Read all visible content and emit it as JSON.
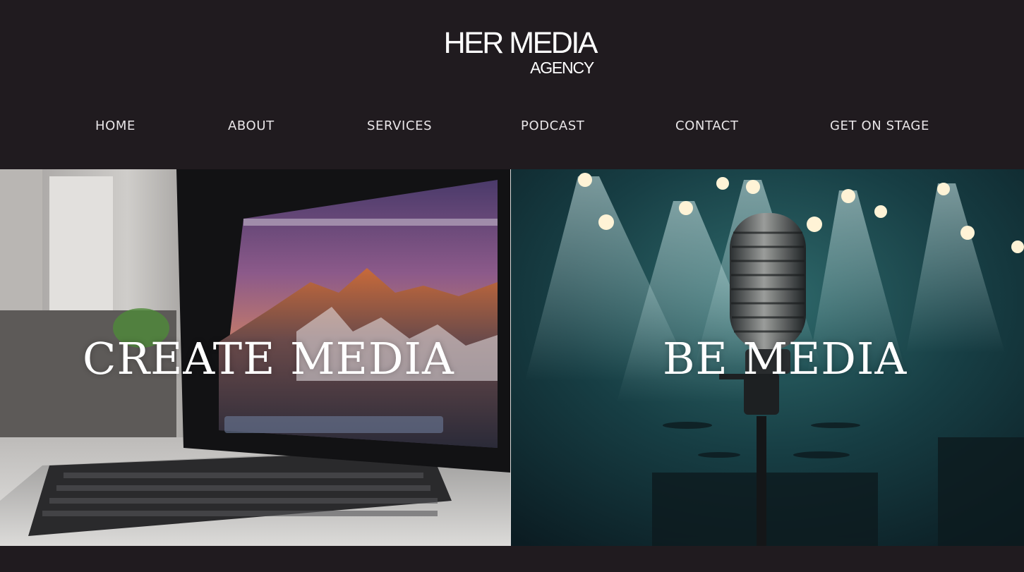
{
  "brand": {
    "name": "HER MEDIA",
    "sub": "AGENCY"
  },
  "nav": {
    "items": [
      {
        "label": "HOME"
      },
      {
        "label": "ABOUT"
      },
      {
        "label": "SERVICES"
      },
      {
        "label": "PODCAST"
      },
      {
        "label": "CONTACT"
      },
      {
        "label": "GET ON STAGE"
      }
    ]
  },
  "hero": {
    "left_title": "CREATE MEDIA",
    "right_title": "BE MEDIA"
  },
  "colors": {
    "background": "#201b1f",
    "text": "#ffffff",
    "nav_text": "#e9e6e8"
  }
}
